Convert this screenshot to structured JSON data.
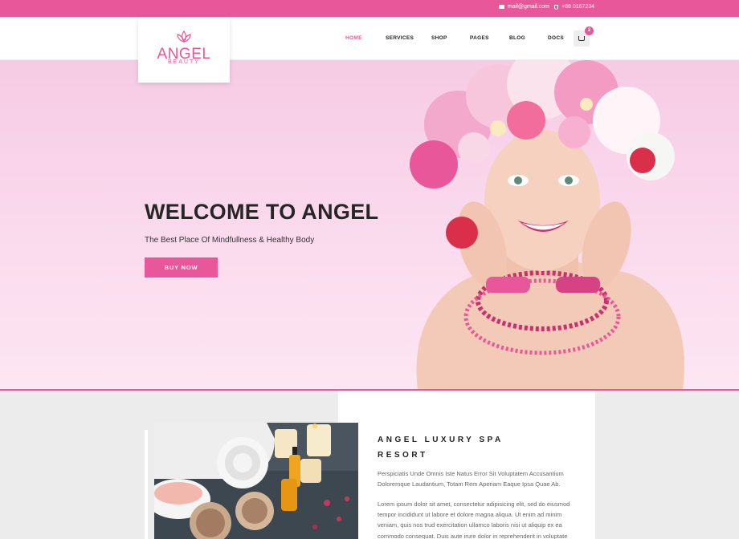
{
  "topbar": {
    "email": "mail@gmail.com",
    "phone": "+88 0167234"
  },
  "logo": {
    "name": "ANGEL",
    "tagline": "BEAUTY"
  },
  "nav": {
    "items": [
      {
        "label": "HOME",
        "active": true
      },
      {
        "label": "SERVICES",
        "active": false
      },
      {
        "label": "SHOP",
        "active": false
      },
      {
        "label": "PAGES",
        "active": false
      },
      {
        "label": "BLOG",
        "active": false
      },
      {
        "label": "DOCS",
        "active": false
      }
    ],
    "cart_count": "2"
  },
  "hero": {
    "title": "WELCOME TO ANGEL",
    "subtitle": "The Best Place Of Mindfullness & Healthy Body",
    "button": "BUY NOW"
  },
  "about": {
    "heading": "ANGEL LUXURY SPA RESORT",
    "paragraph1": "Perspiciatis Unde Omnis Iste Natus Error Sit Voluptatem Accusantium Doloremque Laudantium, Totam Rem Aperiam Eaque Ipsa Quae Ab.",
    "paragraph2": "Lorem ipsum dolor sit amet, consectetur adipisicing elit, sed do eiusmod tempor incididunt ut labore et dolore magna aliqua. Ut enim ad minim veniam, quis nos trud exercitation ullamco laboris nisi ut aliquip ex ea commodo consequat. Duis aute irure dolor in reprehenderit in voluptate"
  },
  "colors": {
    "accent": "#e8579a",
    "hero_bg": "#fad8ec",
    "dark_text": "#262626"
  },
  "icons": {
    "email": "envelope-icon",
    "phone": "phone-icon",
    "cart": "basket-icon",
    "logo": "lotus-icon"
  }
}
